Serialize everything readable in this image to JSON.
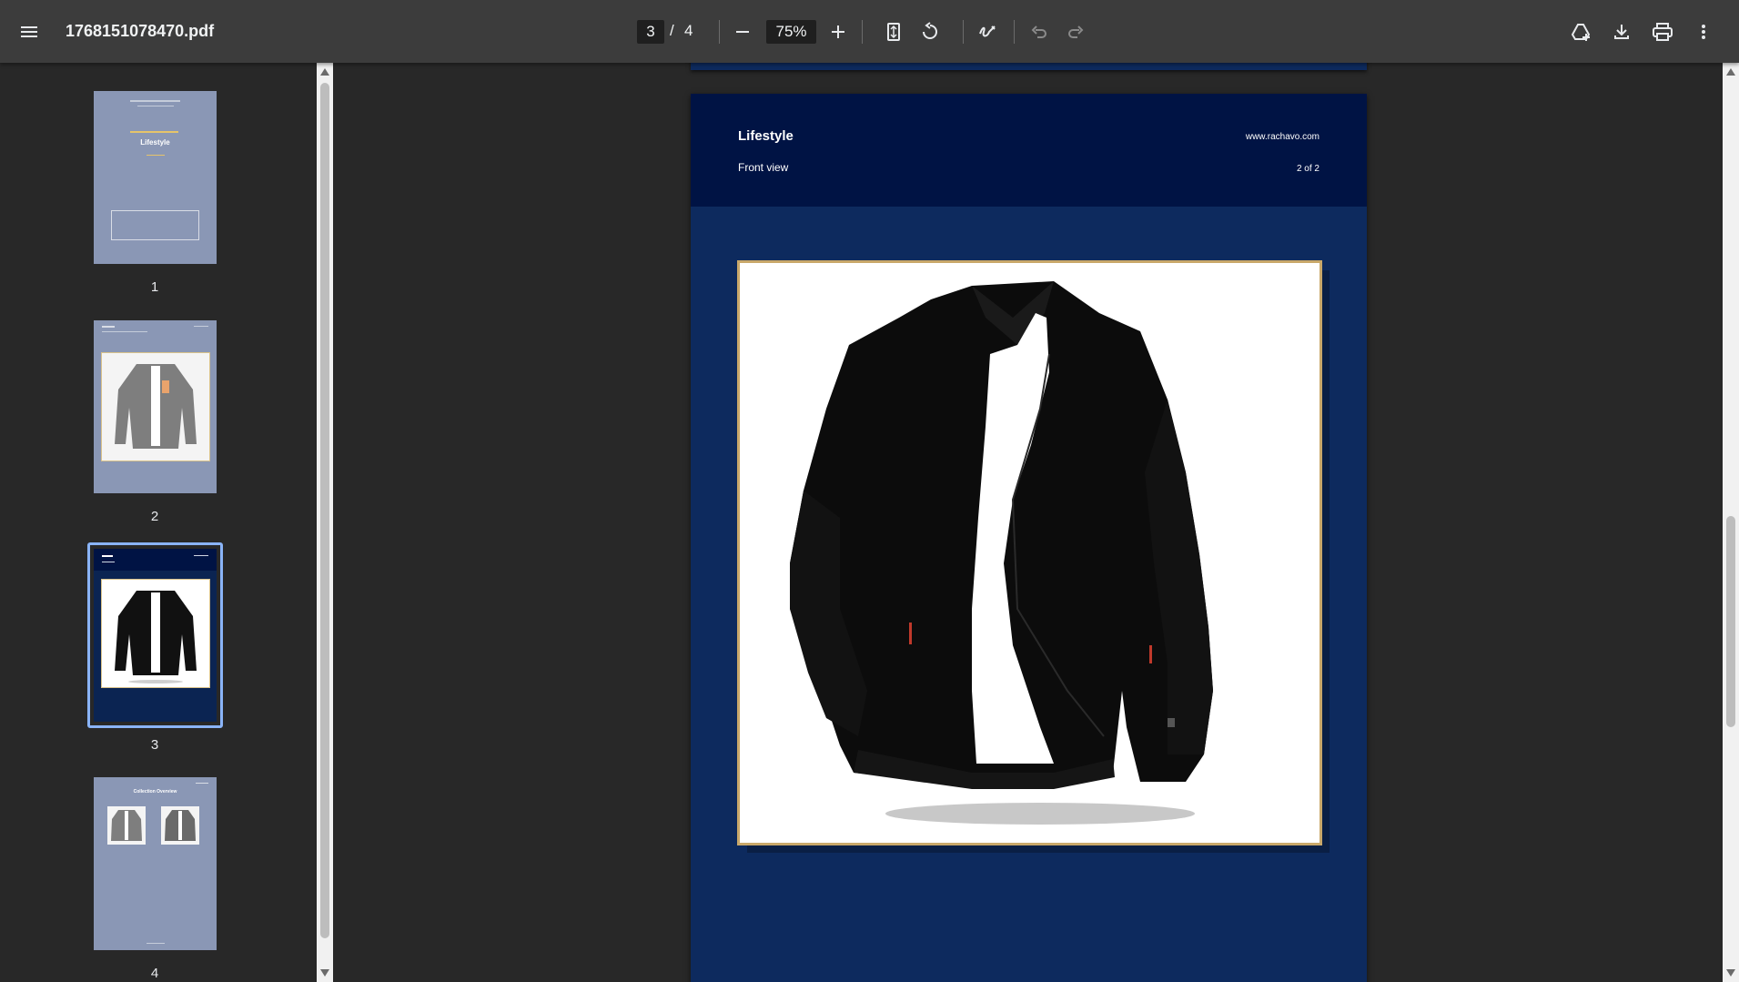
{
  "toolbar": {
    "file_name": "1768151078470.pdf",
    "current_page": "3",
    "page_separator": "/",
    "total_pages": "4",
    "zoom": "75%"
  },
  "icons": {
    "menu": "menu-icon",
    "zoom_out": "minus-icon",
    "zoom_in": "plus-icon",
    "fit": "fit-page-icon",
    "rotate": "rotate-icon",
    "annotate": "draw-icon",
    "undo": "undo-icon",
    "redo": "redo-icon",
    "drive": "add-to-drive-icon",
    "download": "download-icon",
    "print": "print-icon",
    "more": "more-vert-icon"
  },
  "sidebar": {
    "thumbnails": [
      {
        "label": "1",
        "title": "Lifestyle",
        "selected": false
      },
      {
        "label": "2",
        "title": "Lifestyle",
        "selected": false
      },
      {
        "label": "3",
        "title": "Lifestyle",
        "selected": true
      },
      {
        "label": "4",
        "title": "Collection Overview",
        "selected": false
      }
    ]
  },
  "page": {
    "title": "Lifestyle",
    "subtitle": "Front view",
    "website": "www.rachavo.com",
    "counter": "2 of 2",
    "image_alt": "black-jacket-photo"
  },
  "colors": {
    "toolbar_bg": "#3c3c3c",
    "viewer_bg": "#282828",
    "page_bg": "#0d2a5e",
    "header_bg": "#001344",
    "frame_border": "#c9a86a",
    "selection": "#8ab4f8"
  }
}
